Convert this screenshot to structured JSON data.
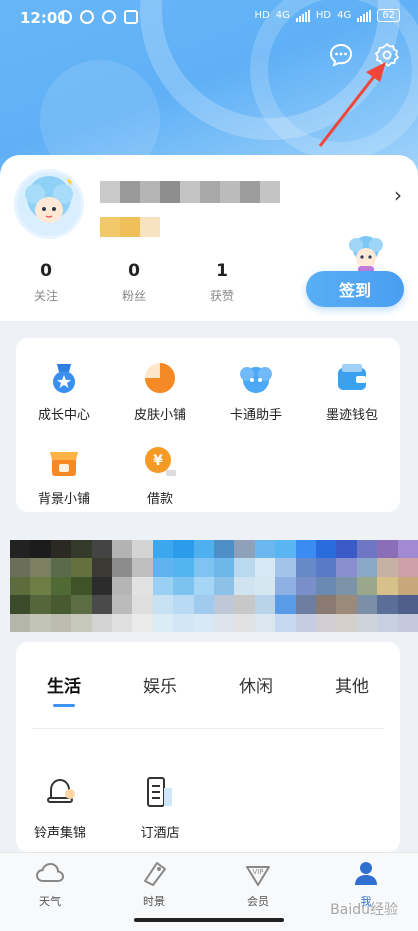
{
  "status_bar": {
    "time": "12:01",
    "network_1": "HD",
    "network_1_gen": "4G",
    "network_2": "HD",
    "network_2_gen": "4G",
    "battery": "62"
  },
  "profile": {
    "stats": [
      {
        "value": "0",
        "label": "关注"
      },
      {
        "value": "0",
        "label": "粉丝"
      },
      {
        "value": "1",
        "label": "获赞"
      }
    ],
    "checkin_label": "签到"
  },
  "tools": [
    {
      "label": "成长中心",
      "icon": "medal-icon",
      "color": "#3a8ff0"
    },
    {
      "label": "皮肤小铺",
      "icon": "skin-shop-icon",
      "color": "#f58a24"
    },
    {
      "label": "卡通助手",
      "icon": "cartoon-assistant-icon",
      "color": "#4aa8f5"
    },
    {
      "label": "墨迹钱包",
      "icon": "wallet-icon",
      "color": "#3aa0f0"
    },
    {
      "label": "背景小铺",
      "icon": "background-shop-icon",
      "color": "#f58a24"
    },
    {
      "label": "借款",
      "icon": "loan-icon",
      "color": "#f59a24"
    }
  ],
  "categories": {
    "tabs": [
      "生活",
      "娱乐",
      "休闲",
      "其他"
    ],
    "active_tab": "生活",
    "items": [
      {
        "label": "铃声集锦",
        "icon": "bell-icon"
      },
      {
        "label": "订酒店",
        "icon": "hotel-icon"
      }
    ]
  },
  "bottom_nav": [
    {
      "label": "天气",
      "icon": "cloud-icon"
    },
    {
      "label": "时景",
      "icon": "tag-icon"
    },
    {
      "label": "会员",
      "icon": "vip-icon"
    },
    {
      "label": "我",
      "icon": "user-icon"
    }
  ],
  "watermark": "Baidu经验"
}
